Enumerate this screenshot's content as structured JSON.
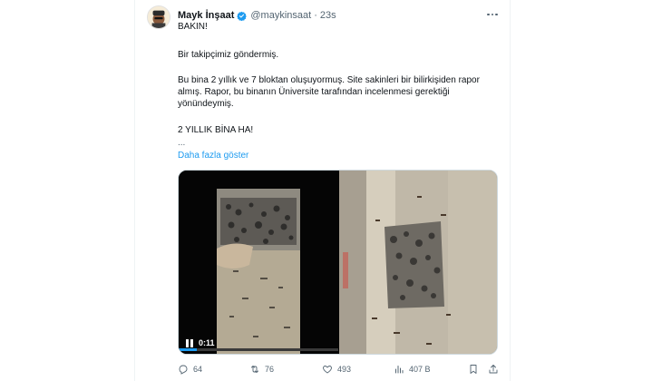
{
  "tweet": {
    "author_name": "Mayk İnşaat",
    "handle": "@maykinsaat",
    "separator": "·",
    "time": "23s",
    "lines": {
      "l1": "BAKIN!",
      "l2": "Bir takipçimiz göndermiş.",
      "l3": "Bu bina 2 yıllık ve 7 bloktan oluşuyormuş. Site sakinleri bir bilirkişiden rapor almış. Rapor, bu binanın Üniversite tarafından incelenmesi gerektiği yönündeymiş.",
      "l4": "2 YILLIK BİNA HA!",
      "l5": "..."
    },
    "show_more": "Daha fazla göster",
    "video_time": "0:11"
  },
  "actions": {
    "replies": "64",
    "retweets": "76",
    "likes": "493",
    "views": "407 B"
  },
  "icons": {
    "verified": "verified-badge-icon",
    "more": "more-options-icon",
    "reply": "reply-icon",
    "retweet": "retweet-icon",
    "like": "heart-icon",
    "views": "views-chart-icon",
    "bookmark": "bookmark-icon",
    "share": "share-icon",
    "pause": "pause-icon"
  },
  "colors": {
    "accent": "#1d9bf0",
    "muted_text": "#536471",
    "text": "#0f1419"
  }
}
